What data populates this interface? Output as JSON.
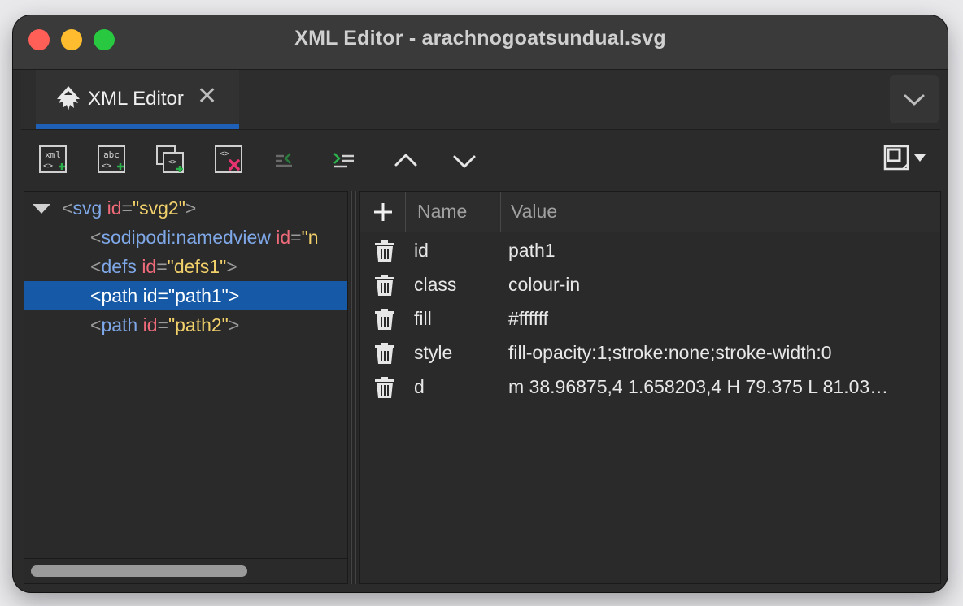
{
  "window": {
    "title": "XML Editor - arachnogoatsundual.svg"
  },
  "tabs": [
    {
      "label": "XML Editor",
      "active": true
    }
  ],
  "toolbar": {
    "buttons": [
      {
        "name": "new-element-node",
        "glyph": "xml"
      },
      {
        "name": "new-text-node",
        "glyph": "abc"
      },
      {
        "name": "duplicate-node"
      },
      {
        "name": "delete-node"
      },
      {
        "name": "unindent-node"
      },
      {
        "name": "indent-node"
      },
      {
        "name": "raise-node"
      },
      {
        "name": "lower-node"
      },
      {
        "name": "layout-menu"
      }
    ]
  },
  "tree": {
    "nodes": [
      {
        "tag": "svg",
        "attr": "id",
        "value": "svg2",
        "depth": 0,
        "expanded": true,
        "selected": false
      },
      {
        "tag": "sodipodi:namedview",
        "attr": "id",
        "value": "n",
        "depth": 1,
        "selected": false,
        "truncated": true
      },
      {
        "tag": "defs",
        "attr": "id",
        "value": "defs1",
        "depth": 1,
        "selected": false
      },
      {
        "tag": "path",
        "attr": "id",
        "value": "path1",
        "depth": 1,
        "selected": true
      },
      {
        "tag": "path",
        "attr": "id",
        "value": "path2",
        "depth": 1,
        "selected": false
      }
    ]
  },
  "attributes": {
    "columns": {
      "name": "Name",
      "value": "Value"
    },
    "rows": [
      {
        "name": "id",
        "value": "path1"
      },
      {
        "name": "class",
        "value": "colour-in"
      },
      {
        "name": "fill",
        "value": "#ffffff"
      },
      {
        "name": "style",
        "value": "fill-opacity:1;stroke:none;stroke-width:0"
      },
      {
        "name": "d",
        "value": "m 38.96875,4 1.658203,4 H 79.375 L 81.03…"
      }
    ]
  },
  "colors": {
    "selection": "#1559a7",
    "tag": "#7fa8e8",
    "attribute": "#ef6b7a",
    "value": "#f2d16b",
    "add_green": "#2bb24c",
    "delete_pink": "#e8336f"
  }
}
